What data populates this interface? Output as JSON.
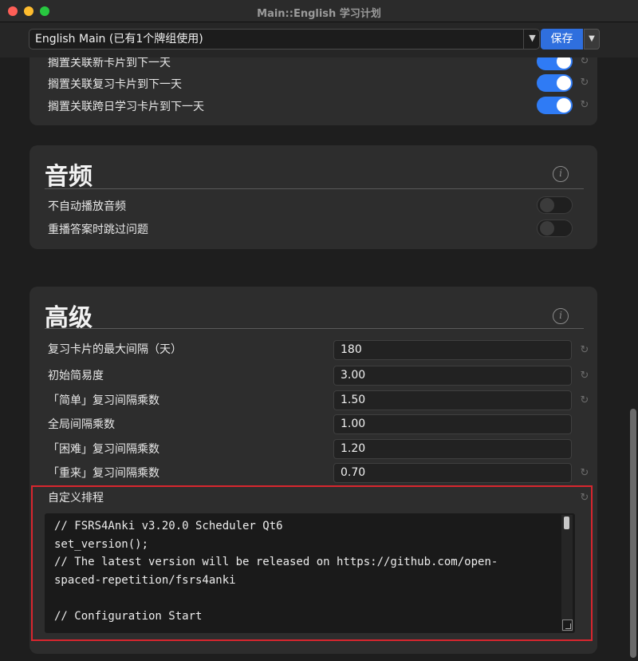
{
  "window": {
    "title": "Main::English 学习计划"
  },
  "toolbar": {
    "preset_value": "English Main (已有1个牌组使用)",
    "save_label": "保存"
  },
  "burying": {
    "items": [
      {
        "label": "搁置关联新卡片到下一天",
        "on": true
      },
      {
        "label": "搁置关联复习卡片到下一天",
        "on": true
      },
      {
        "label": "搁置关联跨日学习卡片到下一天",
        "on": true
      }
    ]
  },
  "audio": {
    "title": "音频",
    "items": [
      {
        "label": "不自动播放音频",
        "on": false
      },
      {
        "label": "重播答案时跳过问题",
        "on": false
      }
    ]
  },
  "advanced": {
    "title": "高级",
    "fields": [
      {
        "label": "复习卡片的最大间隔（天）",
        "value": "180"
      },
      {
        "label": "初始简易度",
        "value": "3.00"
      },
      {
        "label": "「简单」复习间隔乘数",
        "value": "1.50"
      },
      {
        "label": "全局间隔乘数",
        "value": "1.00"
      },
      {
        "label": "「困难」复习间隔乘数",
        "value": "1.20"
      },
      {
        "label": "「重来」复习间隔乘数",
        "value": "0.70"
      }
    ],
    "custom_scheduling": {
      "label": "自定义排程",
      "code_lines": [
        "// FSRS4Anki v3.20.0 Scheduler Qt6",
        "set_version();",
        "// The latest version will be released on https://github.com/open-",
        "spaced-repetition/fsrs4anki",
        "",
        "// Configuration Start"
      ]
    }
  },
  "colors": {
    "accent": "#2f6fde",
    "toggle_on": "#2f7bf5",
    "highlight": "#d8262e"
  }
}
